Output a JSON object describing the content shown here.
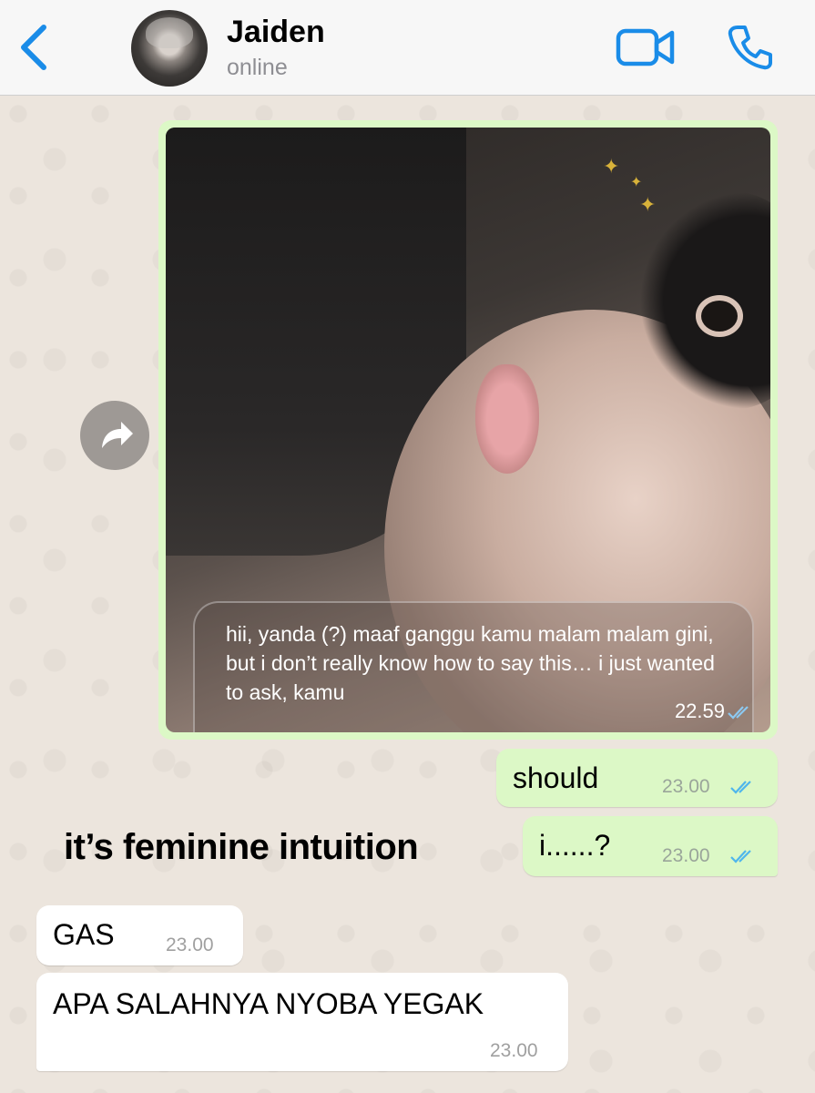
{
  "header": {
    "back_icon": "chevron-left-icon",
    "contact_name": "Jaiden",
    "status": "online",
    "video_icon": "video-camera-icon",
    "call_icon": "phone-icon",
    "accent_color": "#1a8ce8"
  },
  "messages": {
    "media": {
      "caption": "hii, yanda (?) maaf ganggu kamu malam malam gini, but i don’t really know how to say this… i just wanted to ask, kamu",
      "time": "22.59"
    },
    "out1": {
      "text": "should",
      "time": "23.00"
    },
    "out2": {
      "text": "i......?",
      "time": "23.00"
    },
    "in1": {
      "text": "GAS",
      "time": "23.00"
    },
    "in2": {
      "text": "APA SALAHNYA NYOBA YEGAK",
      "time": "23.00"
    }
  },
  "overlay": {
    "text": "it’s feminine intuition"
  },
  "colors": {
    "outgoing_bubble": "#dcf8c6",
    "incoming_bubble": "#ffffff",
    "read_ticks": "#4fb6ec",
    "wallpaper": "#ece5dd"
  }
}
